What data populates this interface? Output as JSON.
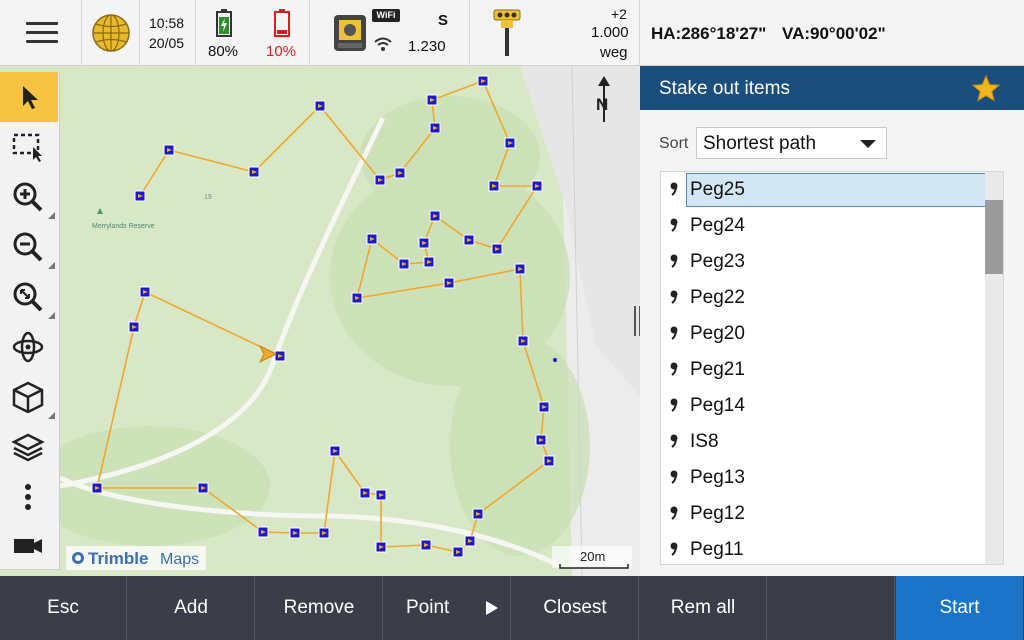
{
  "statusbar": {
    "time": "10:58",
    "date": "20/05",
    "battery_1": "80%",
    "battery_2": "10%",
    "wifi_label": "WiFi",
    "instrument_mode": "S",
    "instrument_value": "1.230",
    "rover_code": "+2",
    "rover_height": "1.000",
    "rover_label": "weg",
    "ha": "HA:286°18'27\"",
    "va": "VA:90°00'02\"",
    "colors": {
      "battery_ok": "#2f8f2f",
      "battery_low": "#d42020"
    }
  },
  "map": {
    "place_label": "Merrylands Reserve",
    "feature_label": "19",
    "north_label": "N",
    "scale_label": "20m",
    "logo_brand": "Trimble",
    "logo_suffix": "Maps"
  },
  "toolbar": {
    "icons": [
      "select-arrow-icon",
      "select-box-icon",
      "zoom-in-icon",
      "zoom-out-icon",
      "zoom-extents-icon",
      "orbit-icon",
      "cube-view-icon",
      "layers-icon",
      "more-icon",
      "camera-icon"
    ]
  },
  "panel": {
    "title": "Stake out items",
    "sort_label": "Sort",
    "sort_value": "Shortest path",
    "items": [
      {
        "label": "Peg25"
      },
      {
        "label": "Peg24"
      },
      {
        "label": "Peg23"
      },
      {
        "label": "Peg22"
      },
      {
        "label": "Peg20"
      },
      {
        "label": "Peg21"
      },
      {
        "label": "Peg14"
      },
      {
        "label": "IS8"
      },
      {
        "label": "Peg13"
      },
      {
        "label": "Peg12"
      },
      {
        "label": "Peg11"
      }
    ],
    "selected_index": 0
  },
  "softkeys": {
    "esc": "Esc",
    "add": "Add",
    "remove": "Remove",
    "point": "Point",
    "closest": "Closest",
    "rem_all": "Rem all",
    "start": "Start"
  },
  "colors": {
    "header": "#1a4f7d",
    "accent": "#1a75c9",
    "path": "#f0a72a",
    "marker": "#1a1acc",
    "star": "#f2b51d"
  }
}
